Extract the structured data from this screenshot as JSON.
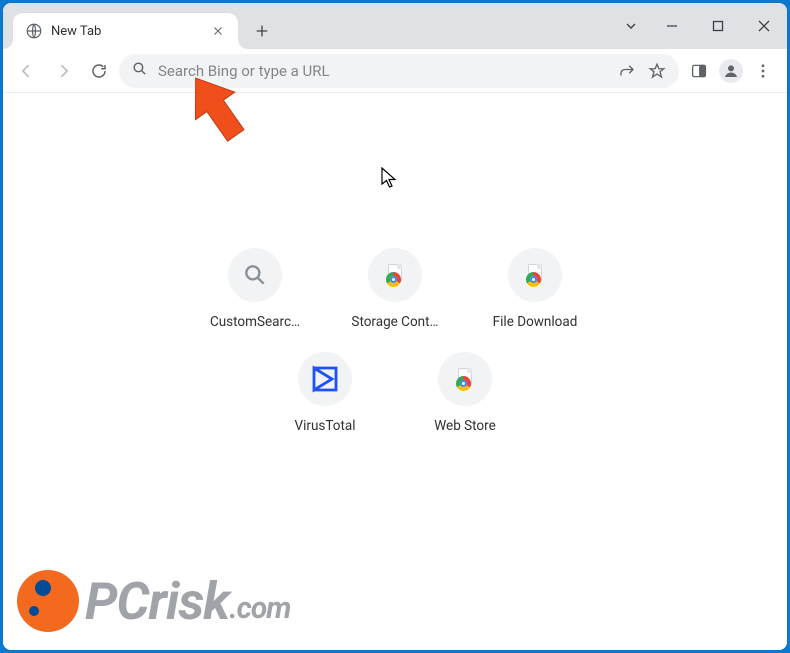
{
  "tab": {
    "title": "New Tab"
  },
  "omnibox": {
    "placeholder": "Search Bing or type a URL"
  },
  "shortcuts": [
    {
      "label": "CustomSearc…",
      "icon": "magnifier"
    },
    {
      "label": "Storage Cont…",
      "icon": "chrome-doc"
    },
    {
      "label": "File Download",
      "icon": "chrome-doc"
    },
    {
      "label": "VirusTotal",
      "icon": "virustotal"
    },
    {
      "label": "Web Store",
      "icon": "chrome-doc"
    }
  ],
  "watermark": {
    "brand_left": "PC",
    "brand_right": "risk",
    "domain": ".com"
  },
  "colors": {
    "accent_arrow": "#f04e1a",
    "titlebar": "#dfe1e5",
    "omnibox_bg": "#f1f3f4",
    "vt_blue": "#1e50ff"
  }
}
